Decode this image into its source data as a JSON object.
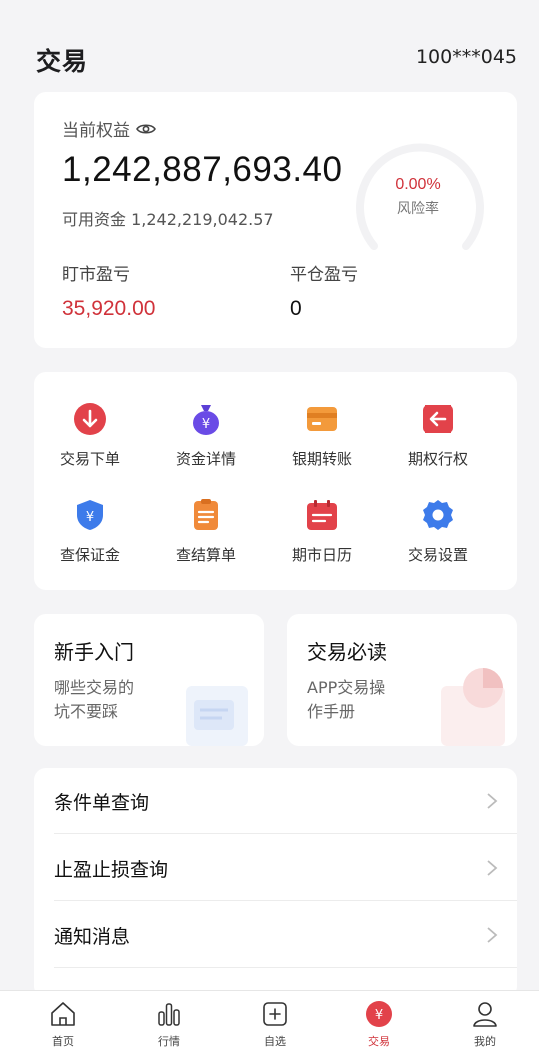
{
  "header": {
    "title": "交易",
    "account": "100***045"
  },
  "equity": {
    "label": "当前权益",
    "value": "1,242,887,693.40",
    "available": "可用资金 1,242,219,042.57",
    "risk_value": "0.00%",
    "risk_label": "风险率",
    "mark_pnl_label": "盯市盈亏",
    "mark_pnl_value": "35,920.00",
    "close_pnl_label": "平仓盈亏",
    "close_pnl_value": "0"
  },
  "grid": [
    {
      "label": "交易下单",
      "icon": "arrow-down-icon"
    },
    {
      "label": "资金详情",
      "icon": "money-bag-icon"
    },
    {
      "label": "银期转账",
      "icon": "bank-card-icon"
    },
    {
      "label": "期权行权",
      "icon": "arrow-left-icon"
    },
    {
      "label": "查保证金",
      "icon": "shield-yuan-icon"
    },
    {
      "label": "查结算单",
      "icon": "clipboard-icon"
    },
    {
      "label": "期市日历",
      "icon": "calendar-icon"
    },
    {
      "label": "交易设置",
      "icon": "gear-icon"
    }
  ],
  "promos": [
    {
      "title": "新手入门",
      "subtitle_line1": "哪些交易的",
      "subtitle_line2": "坑不要踩"
    },
    {
      "title": "交易必读",
      "subtitle_line1": "APP交易操",
      "subtitle_line2": "作手册"
    }
  ],
  "list": [
    {
      "label": "条件单查询"
    },
    {
      "label": "止盈止损查询"
    },
    {
      "label": "通知消息"
    }
  ],
  "tabs": [
    {
      "label": "首页",
      "icon": "home-icon"
    },
    {
      "label": "行情",
      "icon": "bars-icon"
    },
    {
      "label": "自选",
      "icon": "plus-box-icon"
    },
    {
      "label": "交易",
      "icon": "yuan-circle-icon",
      "active": true
    },
    {
      "label": "我的",
      "icon": "user-icon"
    }
  ],
  "colors": {
    "accent": "#d0323a",
    "background": "#f4f4f6",
    "card": "#ffffff"
  }
}
